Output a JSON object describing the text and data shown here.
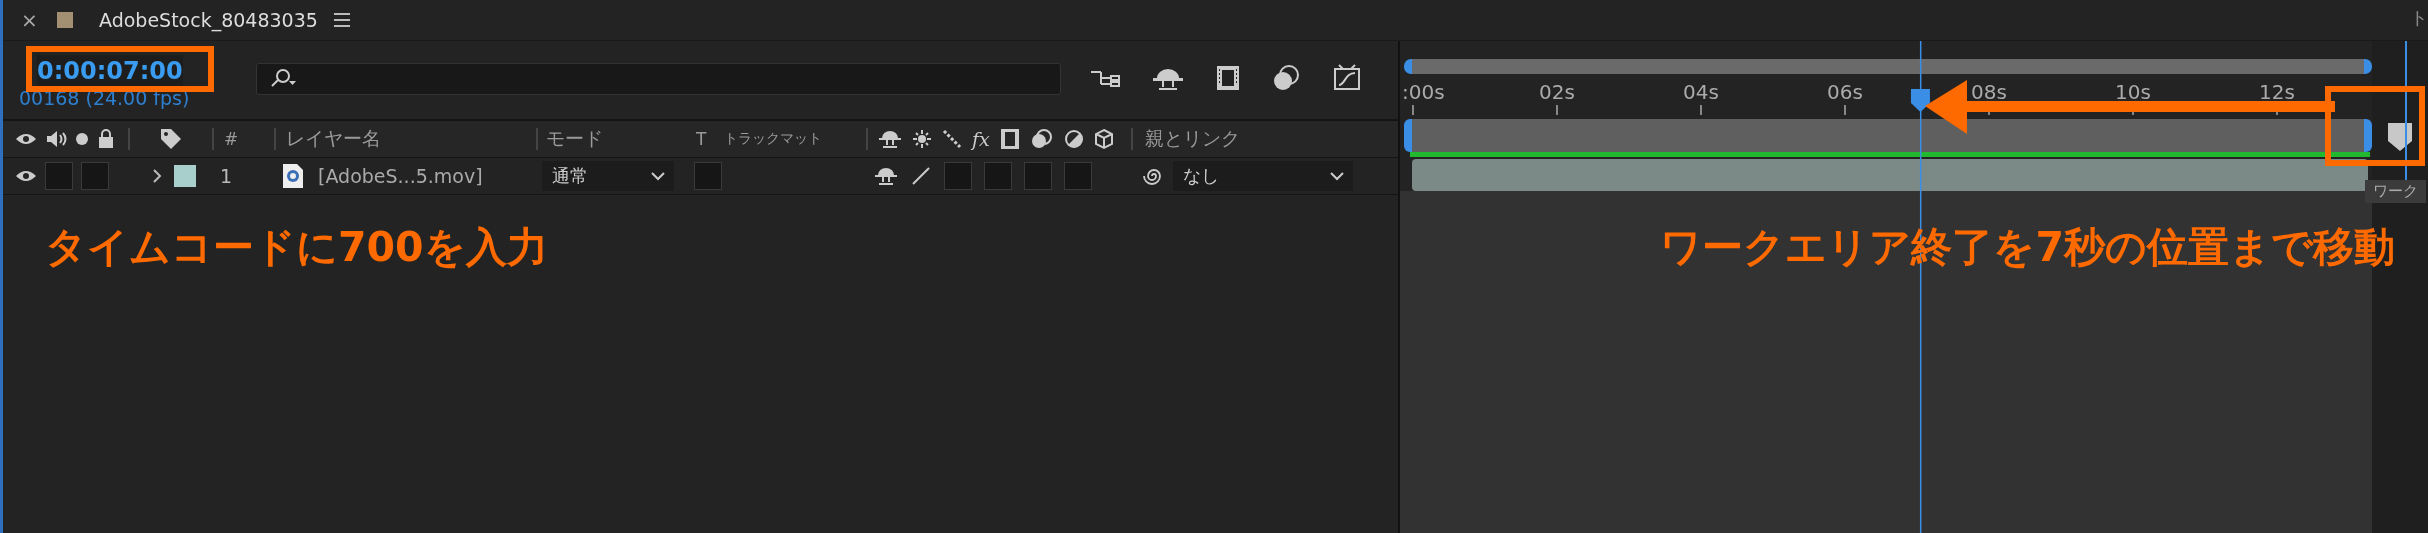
{
  "tab": {
    "title": "AdobeStock_80483035",
    "close": "×"
  },
  "timecode": "0:00:07:00",
  "frame_info": "00168 (24.00 fps)",
  "header": {
    "number": "#",
    "layer_name": "レイヤー名",
    "mode": "モード",
    "t": "T",
    "track_matte": "トラックマット",
    "fx": "fx",
    "parent": "親とリンク"
  },
  "layers": [
    {
      "number": "1",
      "name": "[AdobeS...5.mov]",
      "mode": "通常",
      "parent": "なし",
      "color": "#a8cfcc",
      "visible": true,
      "expanded": false
    }
  ],
  "timeline": {
    "ruler": [
      ":00s",
      "02s",
      "04s",
      "06s",
      "08s",
      "10s",
      "12s"
    ],
    "playhead": {
      "level": 0.533
    },
    "work_area": {
      "level": 1
    },
    "edge_text": "ト",
    "tooltip": "ワーク"
  },
  "captions": [
    "タイムコードに700を入力",
    "ワークエリア終了を7秒の位置まで移動"
  ]
}
